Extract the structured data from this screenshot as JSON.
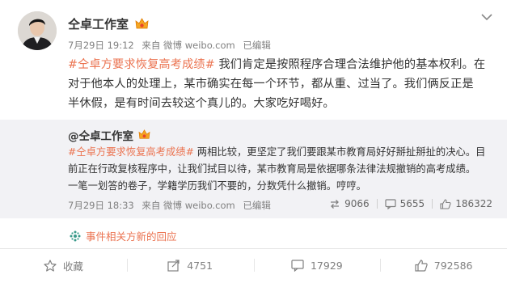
{
  "post": {
    "author": "仝卓工作室",
    "time": "7月29日 19:12",
    "source": "来自 微博 weibo.com",
    "edited": "已编辑",
    "topic": "#仝卓方要求恢复高考成绩#",
    "text_lines": [
      "我们肯定是按照程序合理合法维护他的基本权利。在",
      "对于他本人的处理上，某市确实在每一个环节，都从重、过当了。我们俩反正是",
      "半休假，是有时间去较这个真儿的。大家吃好喝好。"
    ]
  },
  "repost": {
    "author": "@仝卓工作室",
    "topic": "#仝卓方要求恢复高考成绩#",
    "text_lines": [
      "两相比较，更坚定了我们要跟某市教育局好好掰扯掰扯的决心。目",
      "前正在行政复核程序中，让我们拭目以待，某市教育局是依据哪条法律法规撤销的高考成绩。",
      "一笔一划答的卷子，学籍学历我们不要的，分数凭什么撤销。哼哼。"
    ],
    "time": "7月29日 18:33",
    "source": "来自 微博 weibo.com",
    "edited": "已编辑",
    "stats": {
      "reposts": "9066",
      "comments": "5655",
      "likes": "186322"
    }
  },
  "related": "事件相关方新的回应",
  "actions": {
    "favorite": "收藏",
    "repost": "4751",
    "comment": "17929",
    "like": "792586"
  },
  "colors": {
    "topic": "#eb7350",
    "repost_bg": "#f2f2f5",
    "meta": "#808080"
  },
  "icons": [
    "avatar",
    "crown-verified-icon",
    "chevron-down-icon",
    "repost-icon",
    "comment-icon",
    "like-icon",
    "star-icon",
    "related-event-icon"
  ]
}
